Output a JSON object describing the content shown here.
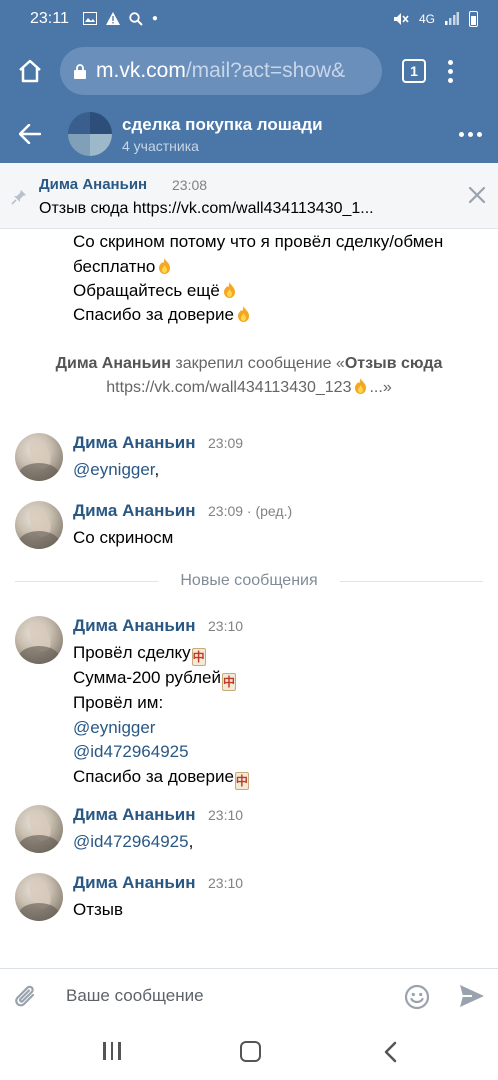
{
  "status_bar": {
    "time": "23:11",
    "network": "4G"
  },
  "browser": {
    "url_host": "m.vk.com",
    "url_path": "/mail?act=show&",
    "tab_count": "1"
  },
  "header": {
    "title": "сделка покупка лошади",
    "subtitle": "4 участника"
  },
  "pinned": {
    "author": "Дима Ананьин",
    "time": "23:08",
    "text": "Отзыв сюда https://vk.com/wall434113430_1..."
  },
  "prev_message_lines": [
    "Со скрином потому что я провёл сделку/обмен",
    "бесплатно",
    "Обращайтесь ещё",
    "Спасибо за доверие"
  ],
  "service_message": {
    "actor": "Дима Ананьин",
    "action": " закрепил сообщение «",
    "quote_bold_1": "Отзыв сюда",
    "quote_line2": "https://vk.com/wall434113430_123",
    "quote_end": "...»"
  },
  "messages": [
    {
      "author": "Дима Ананьин",
      "time": "23:09",
      "lines": [
        "@eynigger"
      ],
      "tail": ","
    },
    {
      "author": "Дима Ананьин",
      "time": "23:09 · (ред.)",
      "lines": [
        "Со скриносм"
      ]
    },
    {
      "author": "Дима Ананьин",
      "time": "23:10",
      "lines": [
        "Провёл сделку",
        "Сумма-200 рублей",
        "Провёл им:",
        "@eynigger",
        "@id472964925",
        "Спасибо за доверие"
      ]
    },
    {
      "author": "Дима Ананьин",
      "time": "23:10",
      "lines": [
        "@id472964925"
      ],
      "tail": ","
    },
    {
      "author": "Дима Ананьин",
      "time": "23:10",
      "lines": [
        "Отзыв"
      ]
    }
  ],
  "separator": {
    "label": "Новые сообщения"
  },
  "composer": {
    "placeholder": "Ваше сообщение"
  },
  "colors": {
    "brand": "#4a76a8",
    "link": "#2a5885"
  }
}
